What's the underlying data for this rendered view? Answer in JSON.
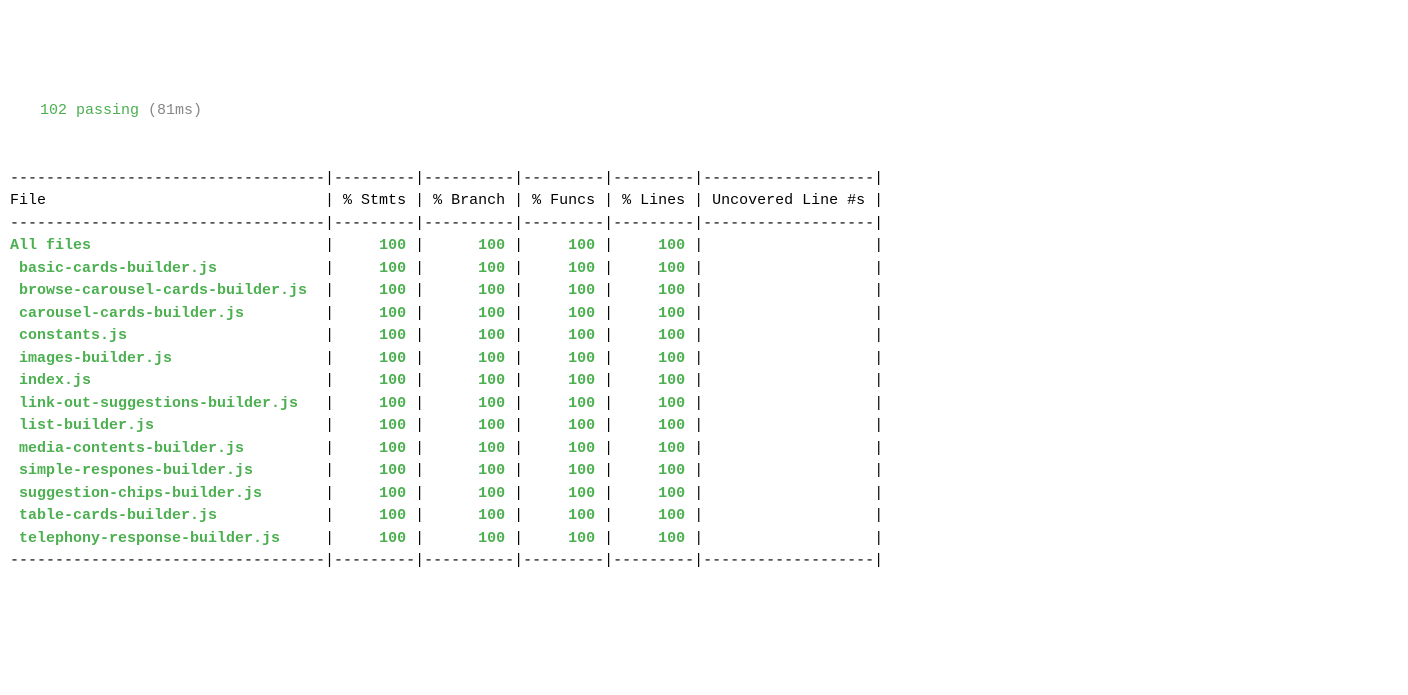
{
  "summary": {
    "passing": "102 passing",
    "time": "(81ms)"
  },
  "header": {
    "file": "File",
    "stmts": "% Stmts",
    "branch": "% Branch",
    "funcs": "% Funcs",
    "lines": "% Lines",
    "uncovered": "Uncovered Line #s"
  },
  "rows": [
    {
      "file": "All files",
      "indent": false,
      "stmts": "100",
      "branch": "100",
      "funcs": "100",
      "lines": "100",
      "uncovered": ""
    },
    {
      "file": "basic-cards-builder.js",
      "indent": true,
      "stmts": "100",
      "branch": "100",
      "funcs": "100",
      "lines": "100",
      "uncovered": ""
    },
    {
      "file": "browse-carousel-cards-builder.js",
      "indent": true,
      "stmts": "100",
      "branch": "100",
      "funcs": "100",
      "lines": "100",
      "uncovered": ""
    },
    {
      "file": "carousel-cards-builder.js",
      "indent": true,
      "stmts": "100",
      "branch": "100",
      "funcs": "100",
      "lines": "100",
      "uncovered": ""
    },
    {
      "file": "constants.js",
      "indent": true,
      "stmts": "100",
      "branch": "100",
      "funcs": "100",
      "lines": "100",
      "uncovered": ""
    },
    {
      "file": "images-builder.js",
      "indent": true,
      "stmts": "100",
      "branch": "100",
      "funcs": "100",
      "lines": "100",
      "uncovered": ""
    },
    {
      "file": "index.js",
      "indent": true,
      "stmts": "100",
      "branch": "100",
      "funcs": "100",
      "lines": "100",
      "uncovered": ""
    },
    {
      "file": "link-out-suggestions-builder.js",
      "indent": true,
      "stmts": "100",
      "branch": "100",
      "funcs": "100",
      "lines": "100",
      "uncovered": ""
    },
    {
      "file": "list-builder.js",
      "indent": true,
      "stmts": "100",
      "branch": "100",
      "funcs": "100",
      "lines": "100",
      "uncovered": ""
    },
    {
      "file": "media-contents-builder.js",
      "indent": true,
      "stmts": "100",
      "branch": "100",
      "funcs": "100",
      "lines": "100",
      "uncovered": ""
    },
    {
      "file": "simple-respones-builder.js",
      "indent": true,
      "stmts": "100",
      "branch": "100",
      "funcs": "100",
      "lines": "100",
      "uncovered": ""
    },
    {
      "file": "suggestion-chips-builder.js",
      "indent": true,
      "stmts": "100",
      "branch": "100",
      "funcs": "100",
      "lines": "100",
      "uncovered": ""
    },
    {
      "file": "table-cards-builder.js",
      "indent": true,
      "stmts": "100",
      "branch": "100",
      "funcs": "100",
      "lines": "100",
      "uncovered": ""
    },
    {
      "file": "telephony-response-builder.js",
      "indent": true,
      "stmts": "100",
      "branch": "100",
      "funcs": "100",
      "lines": "100",
      "uncovered": ""
    }
  ],
  "widths": {
    "file": 35,
    "stmts": 9,
    "branch": 10,
    "funcs": 9,
    "lines": 9,
    "uncovered": 19
  }
}
